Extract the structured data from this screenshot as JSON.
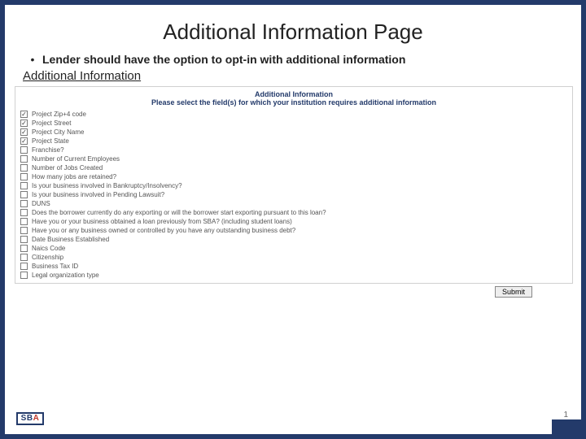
{
  "title": "Additional Information Page",
  "bullet": "Lender should have the option to opt-in with additional information",
  "subhead": "Additional Information",
  "panel": {
    "heading": "Additional Information",
    "instruction": "Please select the field(s) for which your institution requires additional information"
  },
  "items": [
    {
      "label": "Project Zip+4 code",
      "checked": true
    },
    {
      "label": "Project Street",
      "checked": true
    },
    {
      "label": "Project City Name",
      "checked": true
    },
    {
      "label": "Project State",
      "checked": true
    },
    {
      "label": "Franchise?",
      "checked": false
    },
    {
      "label": "Number of Current Employees",
      "checked": false
    },
    {
      "label": "Number of Jobs Created",
      "checked": false
    },
    {
      "label": "How many jobs are retained?",
      "checked": false
    },
    {
      "label": "Is your business involved in Bankruptcy/Insolvency?",
      "checked": false
    },
    {
      "label": "Is your business involved in Pending Lawsuit?",
      "checked": false
    },
    {
      "label": "DUNS",
      "checked": false
    },
    {
      "label": "Does the borrower currently do any exporting or will the borrower start exporting pursuant to this loan?",
      "checked": false
    },
    {
      "label": "Have you or your business obtained a loan previously from SBA? (including student loans)",
      "checked": false
    },
    {
      "label": "Have you or any business owned or controlled by you have any outstanding business debt?",
      "checked": false
    },
    {
      "label": "Date Business Established",
      "checked": false
    },
    {
      "label": "Naics Code",
      "checked": false
    },
    {
      "label": "Citizenship",
      "checked": false
    },
    {
      "label": "Business Tax ID",
      "checked": false
    },
    {
      "label": "Legal organization type",
      "checked": false
    }
  ],
  "submitLabel": "Submit",
  "pageNumber": "1",
  "logo": {
    "text": "SB",
    "accent": "A"
  }
}
